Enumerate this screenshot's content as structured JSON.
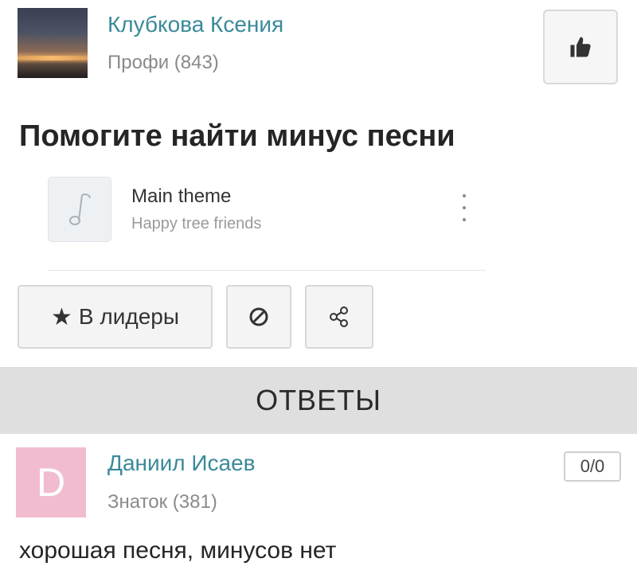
{
  "question": {
    "author": {
      "name": "Клубкова Ксения",
      "rank": "Профи (843)"
    },
    "title": "Помогите найти минус песни",
    "attachment": {
      "title": "Main theme",
      "artist": "Happy tree friends",
      "icon": "music-note-icon"
    },
    "actions": {
      "leaders_label": "В лидеры",
      "leaders_icon": "star-icon",
      "report_icon": "block-icon",
      "share_icon": "share-icon",
      "like_icon": "thumbs-up-icon"
    }
  },
  "answers_header": "ОТВЕТЫ",
  "answers": [
    {
      "avatar_letter": "D",
      "name": "Даниил Исаев",
      "rank": "Знаток (381)",
      "votes": "0/0",
      "text": "хорошая песня, минусов нет"
    }
  ],
  "colors": {
    "name_link": "#3a8a9a",
    "answers_band": "#dfdfdf",
    "answer_avatar": "#f2bcd0"
  }
}
